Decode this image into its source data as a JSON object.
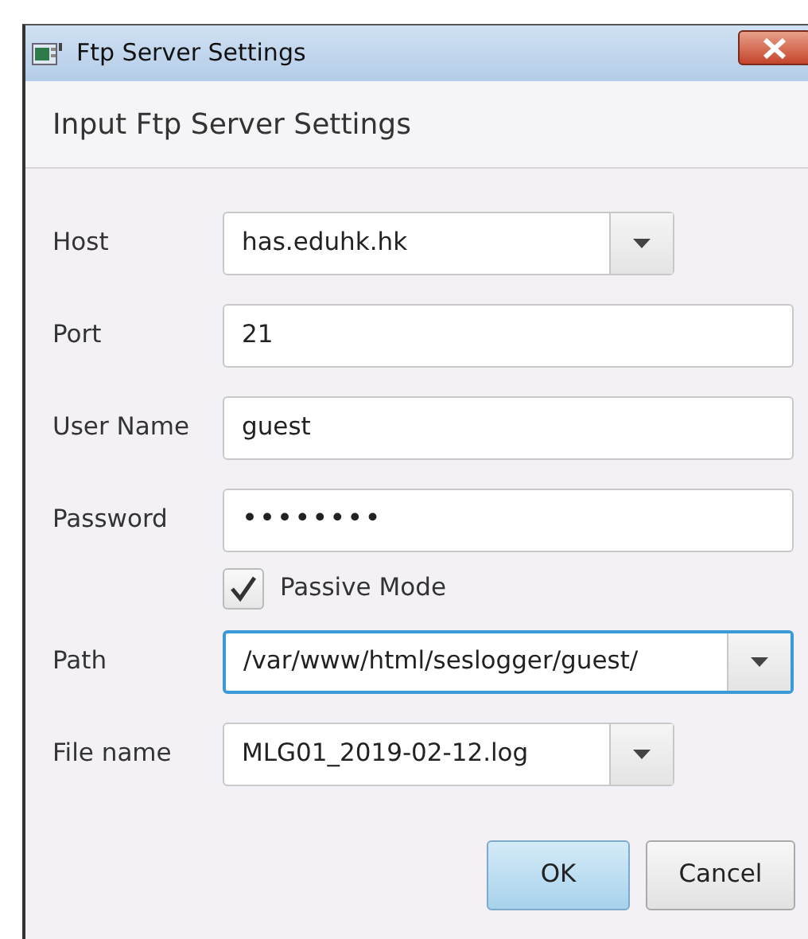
{
  "window": {
    "title": "Ftp Server Settings"
  },
  "header": "Input Ftp Server Settings",
  "fields": [
    {
      "kind": "combo",
      "label": "Host",
      "value": "has.eduhk.hk",
      "focused": false,
      "wide": false
    },
    {
      "kind": "text",
      "label": "Port",
      "value": "21",
      "focused": false,
      "wide": true
    },
    {
      "kind": "text",
      "label": "User Name",
      "value": "guest",
      "focused": false,
      "wide": true
    },
    {
      "kind": "password",
      "label": "Password",
      "value": "••••••••",
      "focused": false,
      "wide": true
    },
    {
      "kind": "checkbox",
      "label": "Passive Mode",
      "checked": true
    },
    {
      "kind": "combo",
      "label": "Path",
      "value": "/var/www/html/seslogger/guest/",
      "focused": true,
      "wide": true
    },
    {
      "kind": "combo",
      "label": "File name",
      "value": "MLG01_2019-02-12.log",
      "focused": false,
      "wide": false
    }
  ],
  "buttons": [
    {
      "label": "OK",
      "default": true
    },
    {
      "label": "Cancel",
      "default": false
    }
  ]
}
